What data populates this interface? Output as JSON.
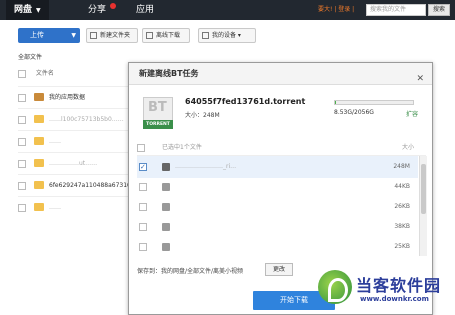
{
  "topbar": {
    "tabs": [
      {
        "label": "网盘"
      },
      {
        "label": "分享"
      },
      {
        "label": "应用"
      }
    ],
    "vip_text": "要大! | 登录 |",
    "search_placeholder": "搜索我的文件",
    "search_button": "搜索"
  },
  "toolbar": {
    "upload": "上传",
    "new_folder": "新建文件夹",
    "offline_download": "离线下载",
    "my_devices": "我的设备"
  },
  "breadcrumb": "全部文件",
  "list": {
    "header": "文件名",
    "rows": [
      {
        "name": "我的应用数据"
      },
      {
        "name": "……l100c75713b5b0……"
      },
      {
        "name": "……"
      },
      {
        "name": "……………ut……"
      },
      {
        "name": "6fe629247a110488a673108…"
      },
      {
        "name": "……"
      }
    ]
  },
  "modal": {
    "title": "新建离线BT任务",
    "bt_label": "BT",
    "torrent_label": "TORRENT",
    "torrent_name": "64055f7fed13761d.torrent",
    "torrent_size": "大小：248M",
    "quota_text": "8.53G/2056G",
    "quota_fraction": 0.004,
    "expand": "扩容",
    "selected_text": "已选中1个文件",
    "size_header": "大小",
    "files": [
      {
        "name": "……………………_ri…",
        "size": "248M",
        "checked": true
      },
      {
        "name": "",
        "size": "44KB",
        "checked": false
      },
      {
        "name": "",
        "size": "26KB",
        "checked": false
      },
      {
        "name": "",
        "size": "38KB",
        "checked": false
      },
      {
        "name": "",
        "size": "25KB",
        "checked": false
      }
    ],
    "save_to": "保存到：我的网盘/全部文件/离美小视频",
    "change": "更改",
    "start": "开始下载"
  },
  "watermark": {
    "title": "当客软件园",
    "url": "www.downkr.com"
  },
  "colors": {
    "topbar": "#222830",
    "primary": "#2f83dd",
    "accent_green": "#4bb04a"
  }
}
